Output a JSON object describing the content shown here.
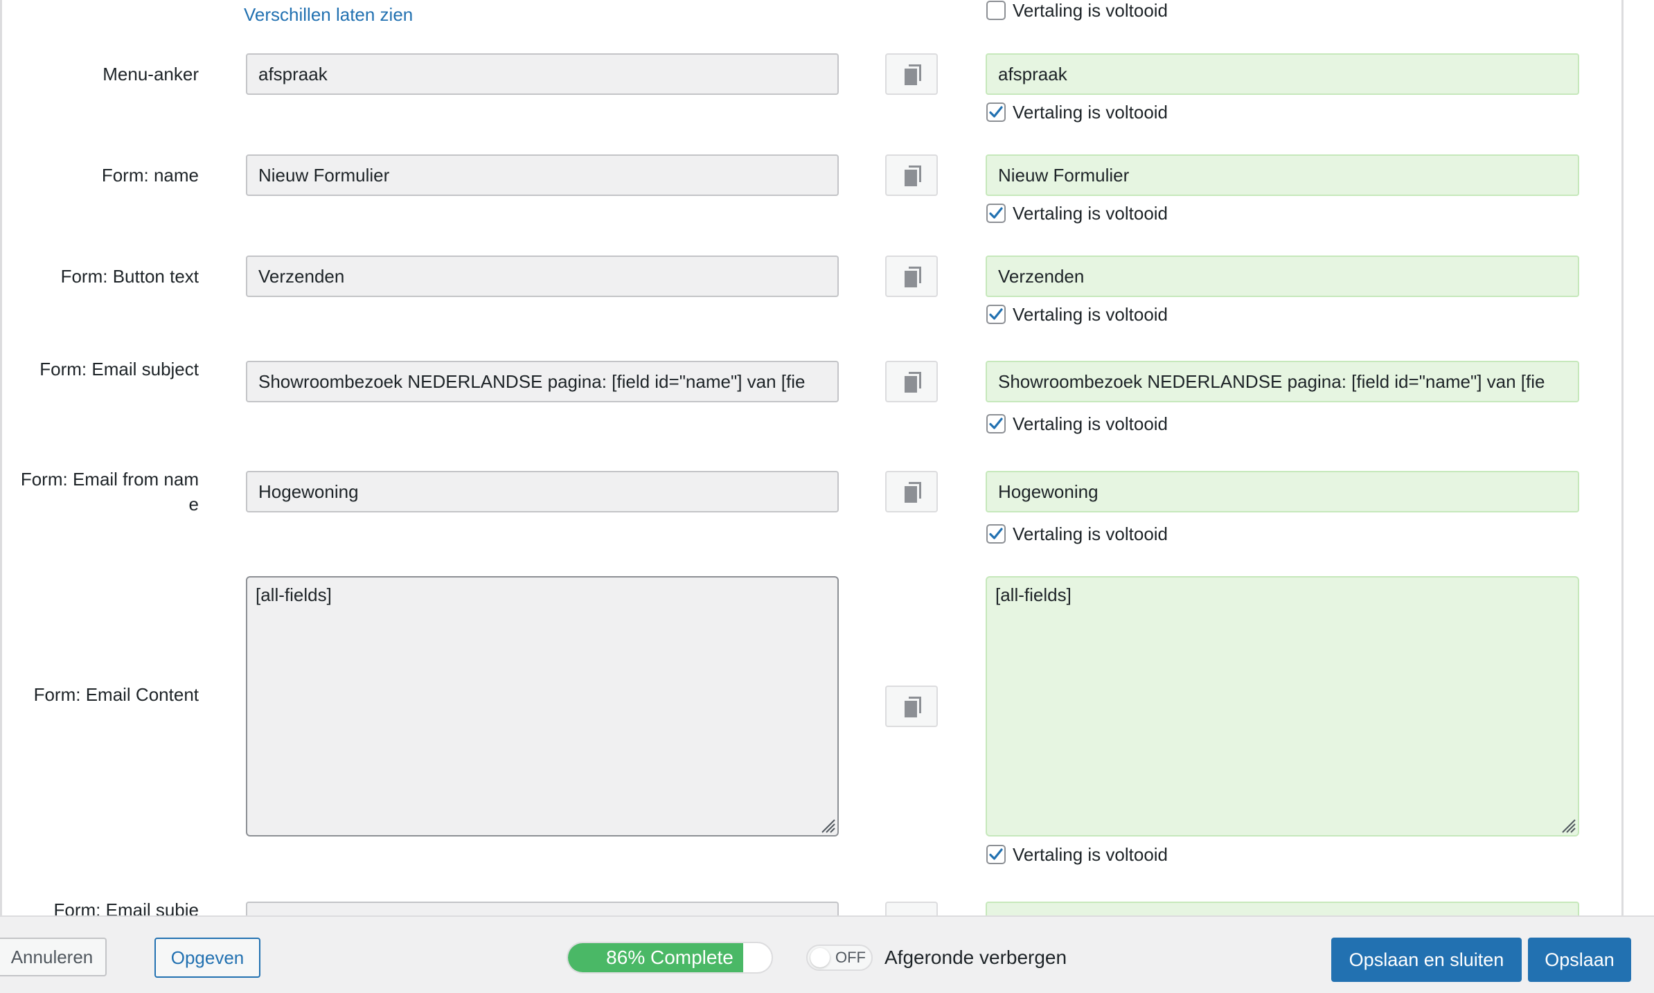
{
  "diff_link": "Verschillen laten zien",
  "complete_label": "Vertaling is voltooid",
  "top_checkbox": {
    "checked": false
  },
  "rows": [
    {
      "label": "Menu-anker",
      "source": "afspraak",
      "target": "afspraak",
      "checked": true
    },
    {
      "label": "Form: name",
      "source": "Nieuw Formulier",
      "target": "Nieuw Formulier",
      "checked": true
    },
    {
      "label": "Form: Button text",
      "source": "Verzenden",
      "target": "Verzenden",
      "checked": true
    },
    {
      "label": "Form: Email subject",
      "source": "Showroombezoek NEDERLANDSE pagina: [field id=\"name\"] van [fie",
      "target": "Showroombezoek NEDERLANDSE pagina: [field id=\"name\"] van [fie",
      "checked": true
    },
    {
      "label": "Form: Email from name",
      "source": "Hogewoning",
      "target": "Hogewoning",
      "checked": true
    },
    {
      "label": "Form: Email Content",
      "source": "[all-fields]",
      "target": "[all-fields]",
      "checked": true
    },
    {
      "label": "Form: Email subje"
    }
  ],
  "footer": {
    "cancel_label": "Annuleren",
    "give_up_label": "Opgeven",
    "progress_text": "86% Complete",
    "progress_fraction": 0.86,
    "toggle_state": "OFF",
    "toggle_label": "Afgeronde verbergen",
    "save_close_label": "Opslaan en sluiten",
    "save_label": "Opslaan"
  },
  "colors": {
    "accent": "#2271b1",
    "progress_green": "#4ab866",
    "target_bg": "#e6f5e1",
    "source_bg": "#f0f0f1"
  },
  "icons": {
    "copy": "copy-icon",
    "check": "check-icon",
    "resize": "resize-handle-icon"
  }
}
